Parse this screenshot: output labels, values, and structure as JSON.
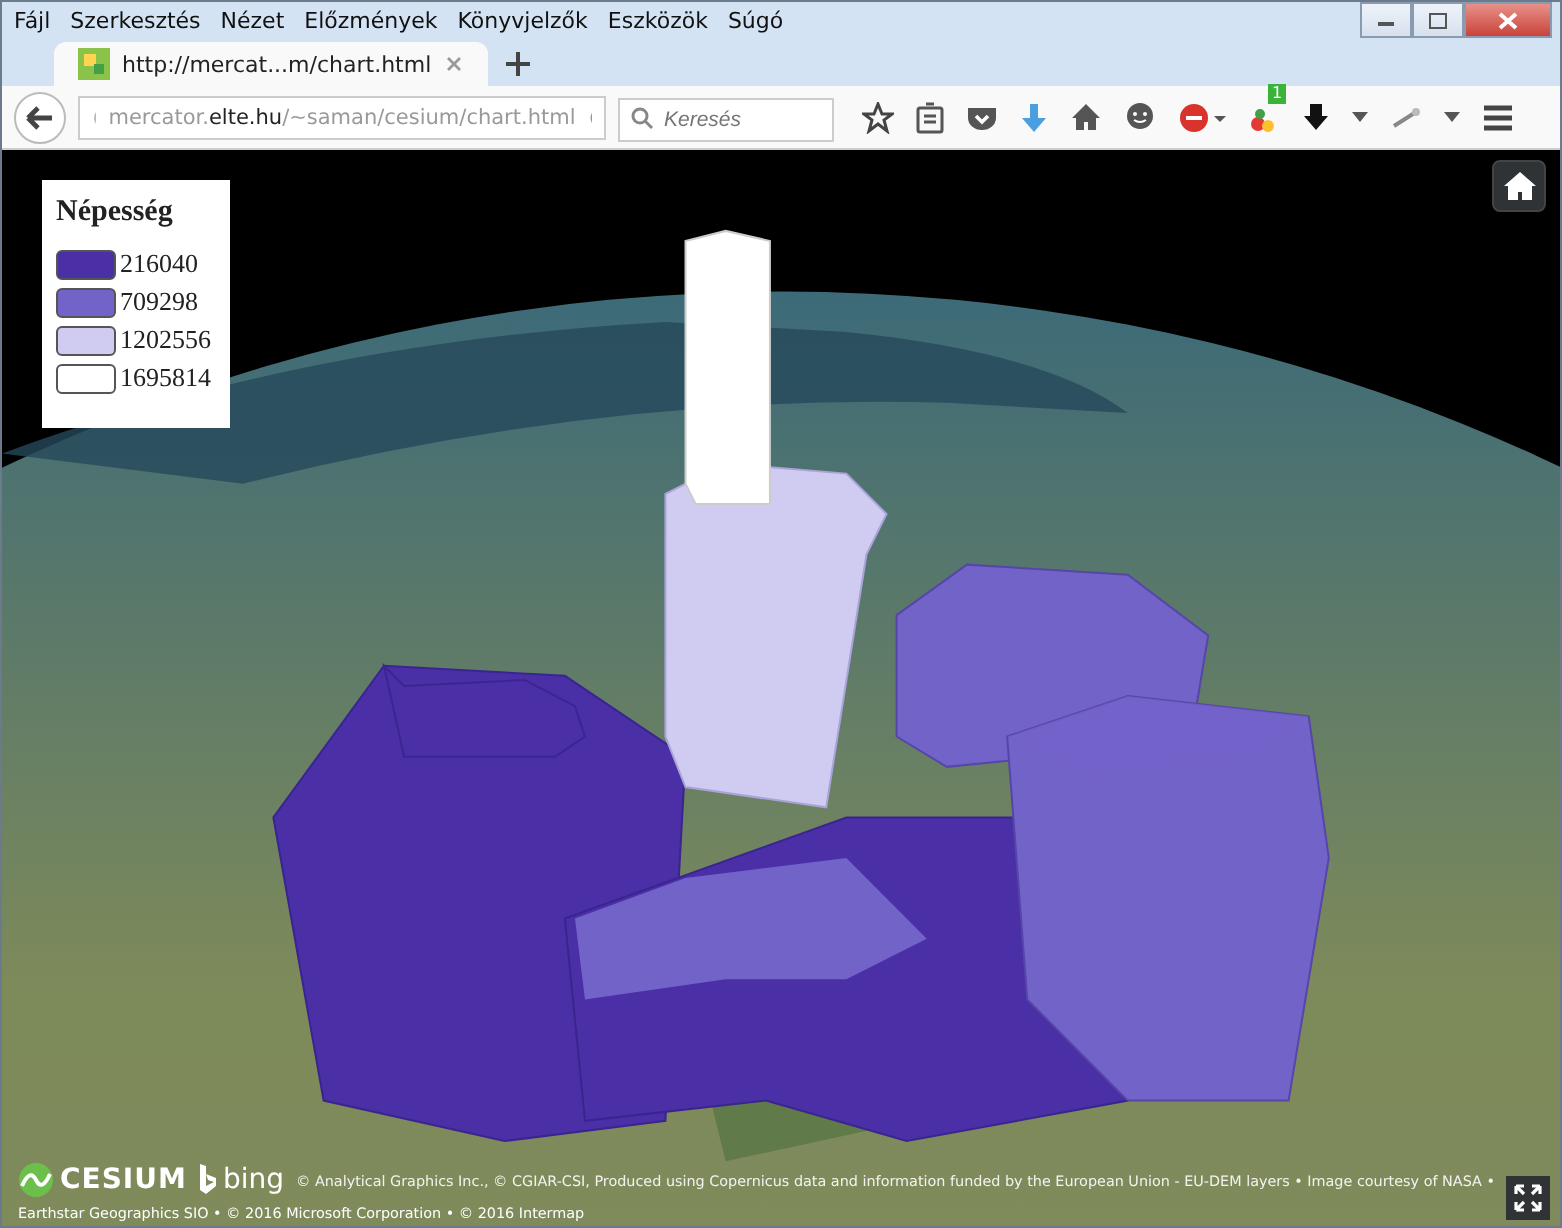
{
  "menu": [
    "Fájl",
    "Szerkesztés",
    "Nézet",
    "Előzmények",
    "Könyvjelzők",
    "Eszközök",
    "Súgó"
  ],
  "tab": {
    "title": "http://mercat...m/chart.html",
    "selected": true
  },
  "address": {
    "value": "mercator.**elte.hu**/~saman/cesium/chart.html"
  },
  "search": {
    "placeholder": "Keresés"
  },
  "toolbar": {
    "badge": "1"
  },
  "legend": {
    "title": "Népesség",
    "items": [
      {
        "label": "216040",
        "color": "#4b2fa6"
      },
      {
        "label": "709298",
        "color": "#7263c9"
      },
      {
        "label": "1202556",
        "color": "#cfcbf1"
      },
      {
        "label": "1695814",
        "color": "#ffffff"
      }
    ]
  },
  "credits": {
    "logo": "CESIUM",
    "bing": "bing",
    "line_1": "© Analytical Graphics Inc., © CGIAR-CSI, Produced using Copernicus data and information funded by the European Union - EU-DEM layers • Image courtesy of NASA •",
    "line_2": "Earthstar Geographics SIO • © 2016 Microsoft Corporation • © 2016 Intermap"
  }
}
